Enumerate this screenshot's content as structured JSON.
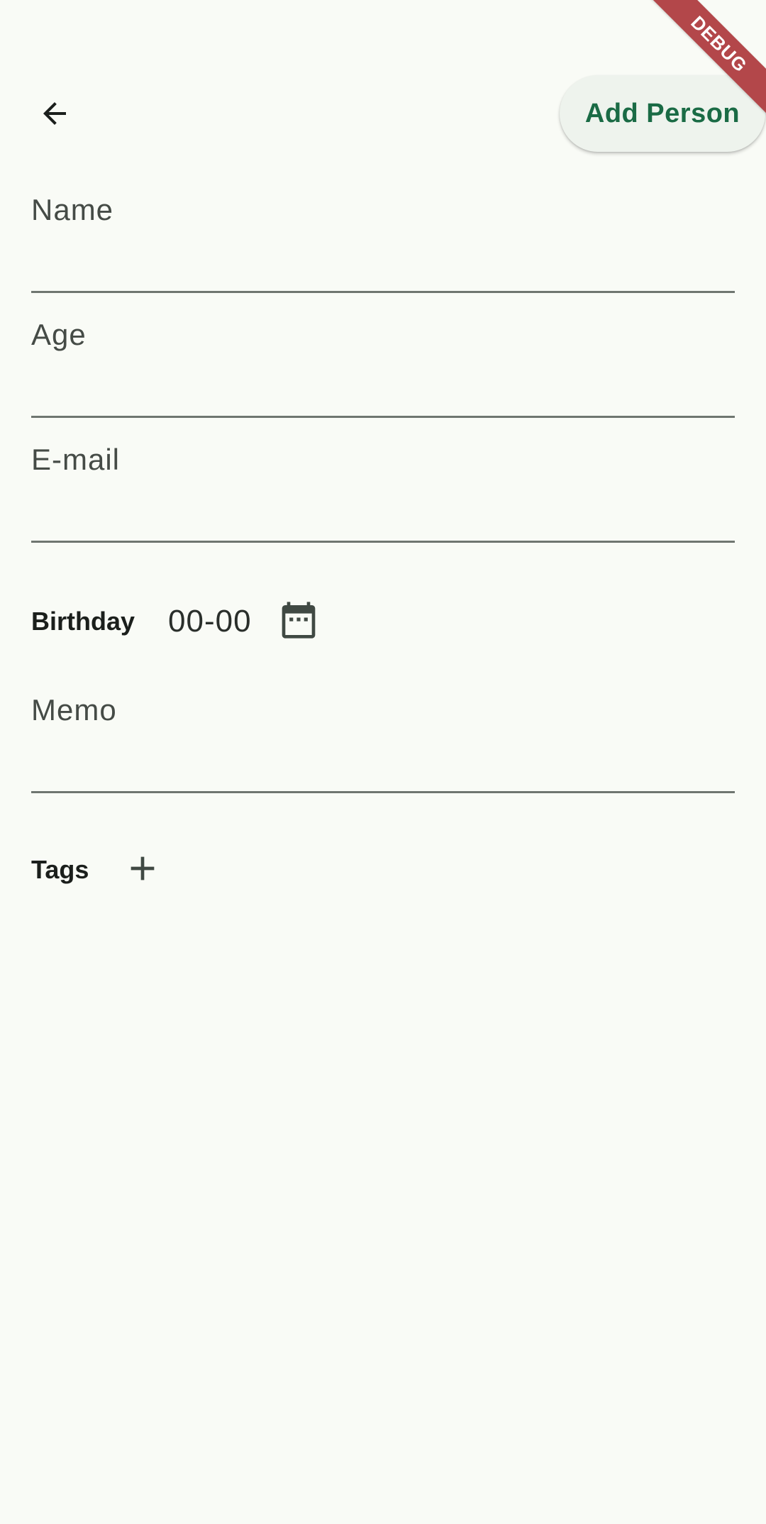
{
  "app_bar": {
    "back_icon": "arrow-back-icon",
    "action_label": "Add Person"
  },
  "form": {
    "name": {
      "label": "Name",
      "value": ""
    },
    "age": {
      "label": "Age",
      "value": ""
    },
    "email": {
      "label": "E-mail",
      "value": ""
    },
    "birthday": {
      "label": "Birthday",
      "value": "00-00",
      "icon": "calendar-icon"
    },
    "memo": {
      "label": "Memo",
      "value": ""
    },
    "tags": {
      "label": "Tags",
      "icon": "plus-icon",
      "items": []
    }
  },
  "debug_banner": {
    "text": "DEBUG"
  },
  "colors": {
    "background": "#f9fbf6",
    "accent": "#1a6b45",
    "button_bg": "#eef3ed",
    "underline": "#6f7670",
    "debug": "#b3474a"
  }
}
